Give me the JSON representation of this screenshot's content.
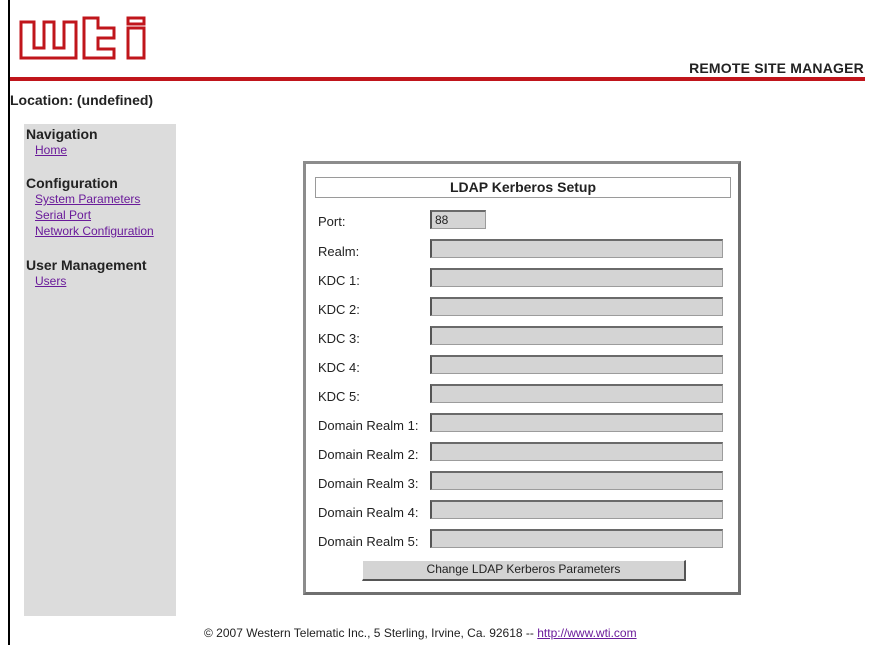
{
  "header": {
    "logo_text": "wti",
    "brand": "REMOTE SITE MANAGER",
    "location": "Location: (undefined)",
    "accent_color": "#c0151b"
  },
  "sidebar": {
    "sections": [
      {
        "heading": "Navigation",
        "links": [
          "Home"
        ]
      },
      {
        "heading": "Configuration",
        "links": [
          "System Parameters",
          "Serial Port",
          "Network Configuration"
        ]
      },
      {
        "heading": "User Management",
        "links": [
          "Users"
        ]
      }
    ]
  },
  "form": {
    "title": "LDAP Kerberos Setup",
    "fields": [
      {
        "label": "Port:",
        "value": "88"
      },
      {
        "label": "Realm:",
        "value": ""
      },
      {
        "label": "KDC 1:",
        "value": ""
      },
      {
        "label": "KDC 2:",
        "value": ""
      },
      {
        "label": "KDC 3:",
        "value": ""
      },
      {
        "label": "KDC 4:",
        "value": ""
      },
      {
        "label": "KDC 5:",
        "value": ""
      },
      {
        "label": "Domain Realm 1:",
        "value": ""
      },
      {
        "label": "Domain Realm 2:",
        "value": ""
      },
      {
        "label": "Domain Realm 3:",
        "value": ""
      },
      {
        "label": "Domain Realm 4:",
        "value": ""
      },
      {
        "label": "Domain Realm 5:",
        "value": ""
      }
    ],
    "submit_label": "Change LDAP Kerberos Parameters"
  },
  "footer": {
    "text": "© 2007 Western Telematic Inc., 5 Sterling, Irvine, Ca. 92618 -- ",
    "link": "http://www.wti.com"
  }
}
